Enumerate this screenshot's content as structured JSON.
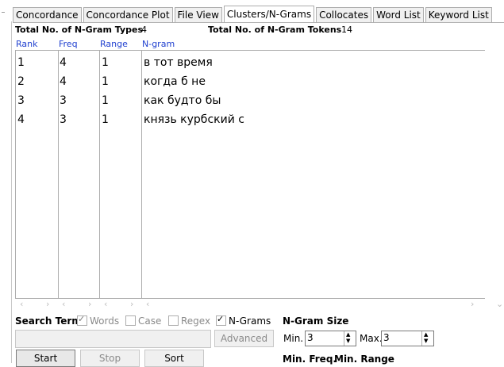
{
  "tabs": [
    {
      "label": "Concordance",
      "active": false
    },
    {
      "label": "Concordance Plot",
      "active": false
    },
    {
      "label": "File View",
      "active": false
    },
    {
      "label": "Clusters/N-Grams",
      "active": true
    },
    {
      "label": "Collocates",
      "active": false
    },
    {
      "label": "Word List",
      "active": false
    },
    {
      "label": "Keyword List",
      "active": false
    }
  ],
  "stats": {
    "types_label": "Total No. of N-Gram Types",
    "types_value": "4",
    "tokens_label": "Total No. of N-Gram Tokens",
    "tokens_value": "14"
  },
  "columns": {
    "rank": "Rank",
    "freq": "Freq",
    "range": "Range",
    "ngram": "N-gram"
  },
  "rows": [
    {
      "rank": "1",
      "freq": "4",
      "range": "1",
      "ngram": "в тот время"
    },
    {
      "rank": "2",
      "freq": "4",
      "range": "1",
      "ngram": "когда б не"
    },
    {
      "rank": "3",
      "freq": "3",
      "range": "1",
      "ngram": "как будто бы"
    },
    {
      "rank": "4",
      "freq": "3",
      "range": "1",
      "ngram": "князь курбский с"
    }
  ],
  "search": {
    "label": "Search Term",
    "words": "Words",
    "words_checked": true,
    "case": "Case",
    "case_checked": false,
    "regex": "Regex",
    "regex_checked": false,
    "ngrams": "N-Grams",
    "ngrams_checked": true,
    "advanced": "Advanced",
    "value": ""
  },
  "ngram_size": {
    "label": "N-Gram Size",
    "min_label": "Min.",
    "min_value": "3",
    "max_label": "Max.",
    "max_value": "3"
  },
  "buttons": {
    "start": "Start",
    "stop": "Stop",
    "sort": "Sort"
  },
  "bottom_labels": {
    "min_freq": "Min. Freq.",
    "min_range": "Min. Range"
  },
  "icons": {
    "scroll_left": "‹",
    "scroll_right": "›",
    "scroll_down": "⌄"
  }
}
